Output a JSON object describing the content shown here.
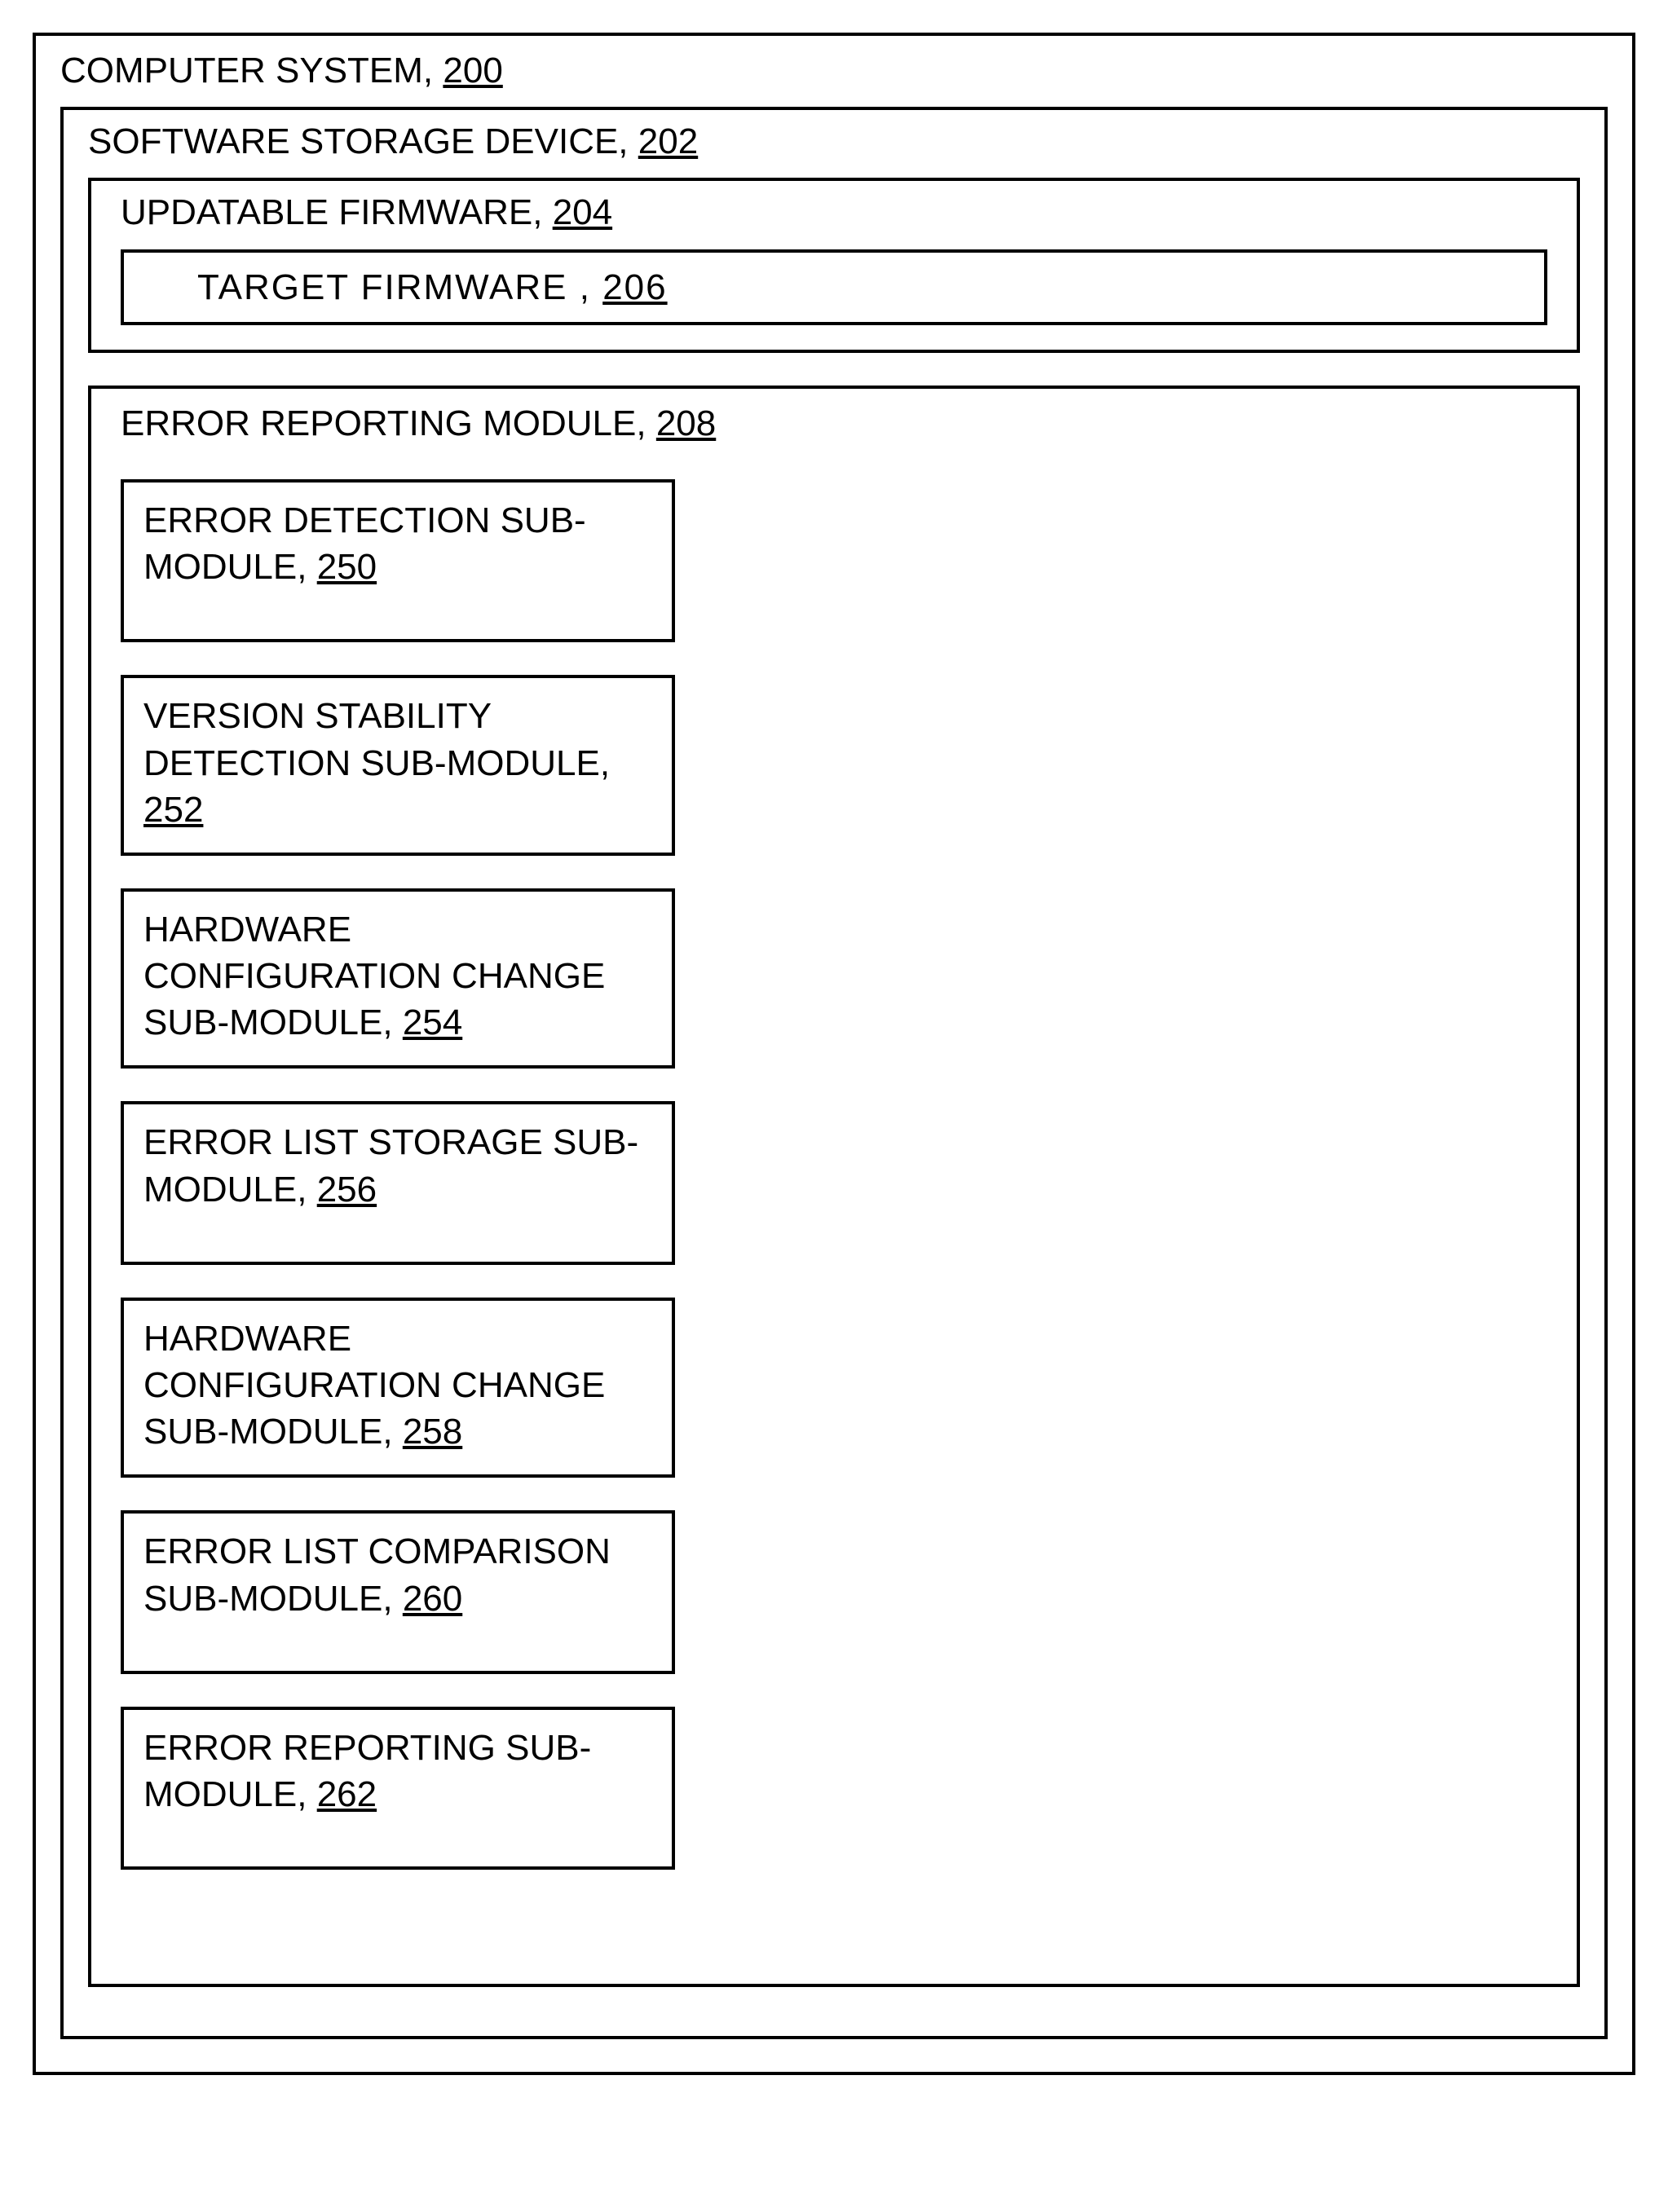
{
  "computer_system": {
    "label": "COMPUTER SYSTEM, ",
    "ref": "200"
  },
  "storage_device": {
    "label": "SOFTWARE STORAGE DEVICE, ",
    "ref": "202"
  },
  "updatable_firmware": {
    "label": "UPDATABLE FIRMWARE, ",
    "ref": "204"
  },
  "target_firmware": {
    "label": "TARGET  FIRMWARE       , ",
    "ref": "206"
  },
  "error_module": {
    "label": "ERROR REPORTING MODULE, ",
    "ref": "208"
  },
  "submodules": [
    {
      "label": "ERROR DETECTION SUB-MODULE, ",
      "ref": "250"
    },
    {
      "label": "VERSION STABILITY DETECTION SUB-MODULE, ",
      "ref": "252"
    },
    {
      "label": "HARDWARE CONFIGURATION CHANGE SUB-MODULE, ",
      "ref": "254"
    },
    {
      "label": "ERROR LIST STORAGE SUB-MODULE, ",
      "ref": "256"
    },
    {
      "label": "HARDWARE CONFIGURATION CHANGE SUB-MODULE, ",
      "ref": "258"
    },
    {
      "label": "ERROR LIST COMPARISON SUB-MODULE, ",
      "ref": "260"
    },
    {
      "label": "ERROR REPORTING SUB-MODULE, ",
      "ref": "262"
    }
  ]
}
